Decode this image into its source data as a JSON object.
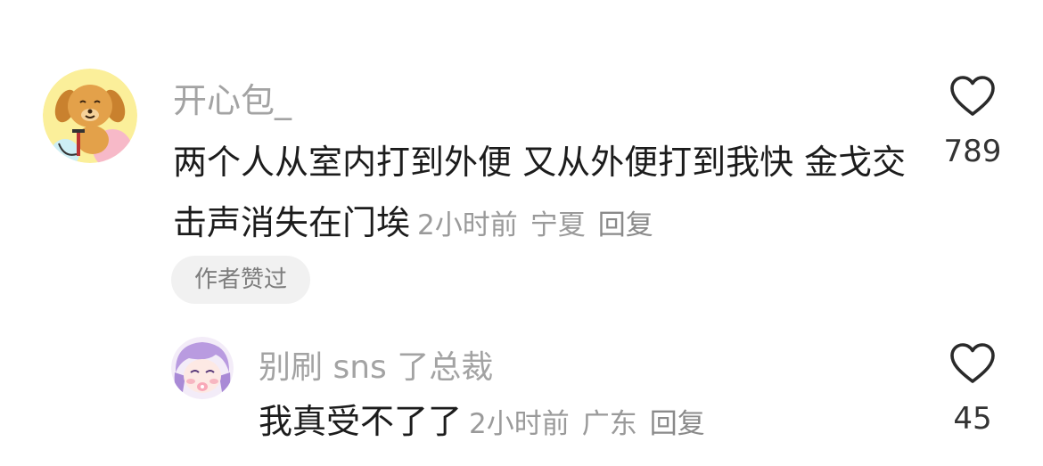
{
  "comments": [
    {
      "username": "开心包_",
      "avatar_icon": "cartoon-dog-icon",
      "text": "两个人从室内打到外便 又从外便打到我快 金戈交击声消失在门埃",
      "time": "2小时前",
      "location": "宁夏",
      "reply_label": "回复",
      "badge": "作者赞过",
      "like_icon": "heart-outline-icon",
      "like_count": "789"
    },
    {
      "username": "别刷 sns 了总裁",
      "avatar_icon": "anime-girl-icon",
      "text": "我真受不了了",
      "time": "2小时前",
      "location": "广东",
      "reply_label": "回复",
      "like_icon": "heart-outline-icon",
      "like_count": "45"
    }
  ],
  "colors": {
    "username": "#a3a3a3",
    "text": "#1c1c1c",
    "meta": "#9a9a9a",
    "badge_bg": "#f1f1f1"
  }
}
